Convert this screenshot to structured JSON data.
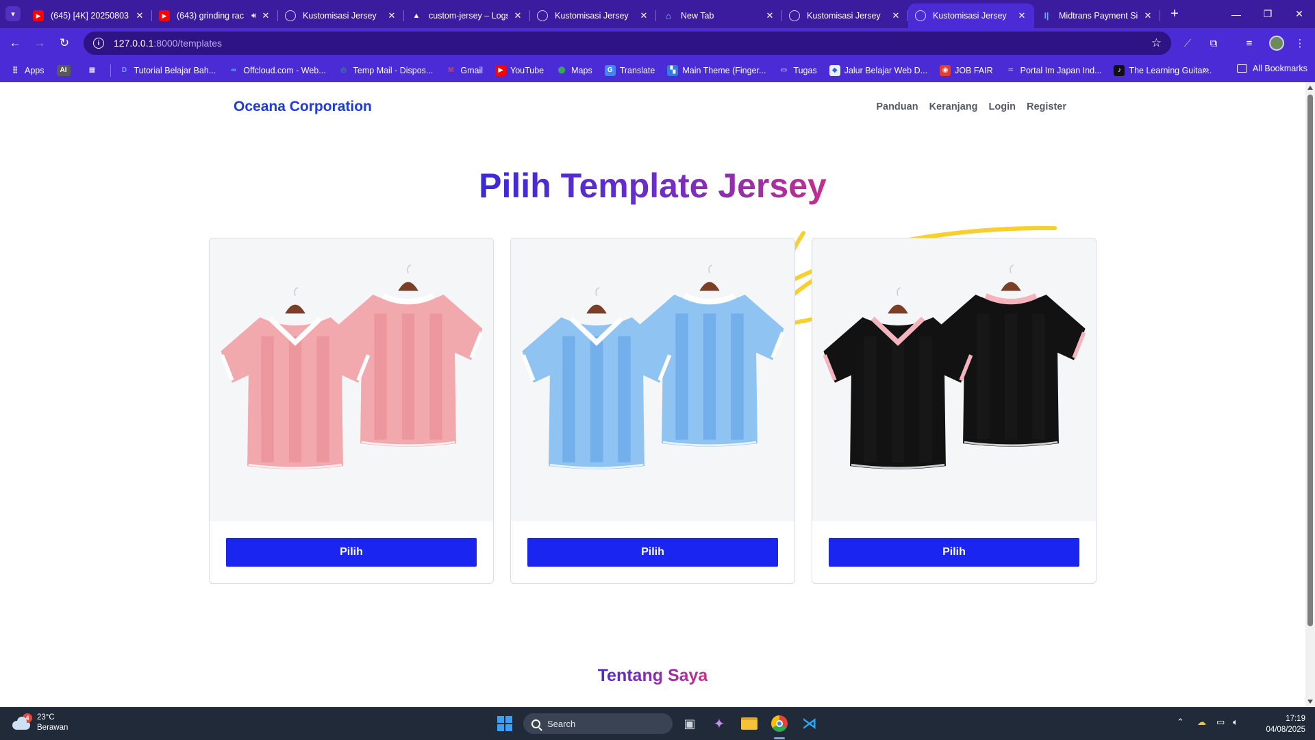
{
  "browser": {
    "tabs": [
      {
        "title": "(645) [4K] 20250803",
        "favicon": "youtube-icon",
        "active": false
      },
      {
        "title": "(643) grinding rac",
        "favicon": "youtube-icon",
        "active": false,
        "audio": true
      },
      {
        "title": "Kustomisasi Jersey",
        "favicon": "globe-icon",
        "active": false
      },
      {
        "title": "custom-jersey – Logs",
        "favicon": "vercel-icon",
        "active": false
      },
      {
        "title": "Kustomisasi Jersey",
        "favicon": "globe-icon",
        "active": false
      },
      {
        "title": "New Tab",
        "favicon": "home-icon",
        "active": false
      },
      {
        "title": "Kustomisasi Jersey",
        "favicon": "globe-icon",
        "active": false
      },
      {
        "title": "Kustomisasi Jersey",
        "favicon": "globe-icon",
        "active": true
      },
      {
        "title": "Midtrans Payment Sir",
        "favicon": "midtrans-icon",
        "active": false
      }
    ],
    "url_host": "127.0.0.1",
    "url_path": ":8000/templates",
    "bookmarks": [
      {
        "label": "Apps",
        "icon": "apps-grid-icon"
      },
      {
        "label": "AI",
        "icon": "ai-badge-icon"
      },
      {
        "label": "",
        "icon": "grid-icon"
      },
      {
        "label": "Tutorial Belajar Bah...",
        "icon": "d-icon"
      },
      {
        "label": "Offcloud.com - Web...",
        "icon": "offcloud-icon"
      },
      {
        "label": "Temp Mail - Dispos...",
        "icon": "tempmail-icon"
      },
      {
        "label": "Gmail",
        "icon": "gmail-icon"
      },
      {
        "label": "YouTube",
        "icon": "youtube-icon"
      },
      {
        "label": "Maps",
        "icon": "maps-icon"
      },
      {
        "label": "Translate",
        "icon": "translate-icon"
      },
      {
        "label": "Main Theme (Finger...",
        "icon": "theme-icon"
      },
      {
        "label": "Tugas",
        "icon": "folder-icon"
      },
      {
        "label": "Jalur Belajar Web D...",
        "icon": "learn-icon"
      },
      {
        "label": "JOB FAIR",
        "icon": "jobfair-icon"
      },
      {
        "label": "Portal Im Japan Ind...",
        "icon": "portal-icon"
      },
      {
        "label": "The Learning Guitar...",
        "icon": "guitar-icon"
      }
    ],
    "all_bookmarks": "All Bookmarks"
  },
  "site": {
    "brand": "Oceana Corporation",
    "nav": [
      "Panduan",
      "Keranjang",
      "Login",
      "Register"
    ],
    "headline": "Pilih Template Jersey",
    "templates": [
      {
        "button": "Pilih",
        "primary": "#f2a9ad",
        "trim": "#ffffff",
        "stripe": "#e8898f"
      },
      {
        "button": "Pilih",
        "primary": "#8ec3f2",
        "trim": "#ffffff",
        "stripe": "#5b9fe6"
      },
      {
        "button": "Pilih",
        "primary": "#121212",
        "trim": "#f3b4bd",
        "stripe": "#1c1c1c"
      }
    ],
    "section_title": "Tentang Saya",
    "accent_color": "#1a25f0"
  },
  "taskbar": {
    "weather_temp": "23°C",
    "weather_desc": "Berawan",
    "weather_badge": "4",
    "search_placeholder": "Search",
    "time": "17:19",
    "date": "04/08/2025"
  }
}
